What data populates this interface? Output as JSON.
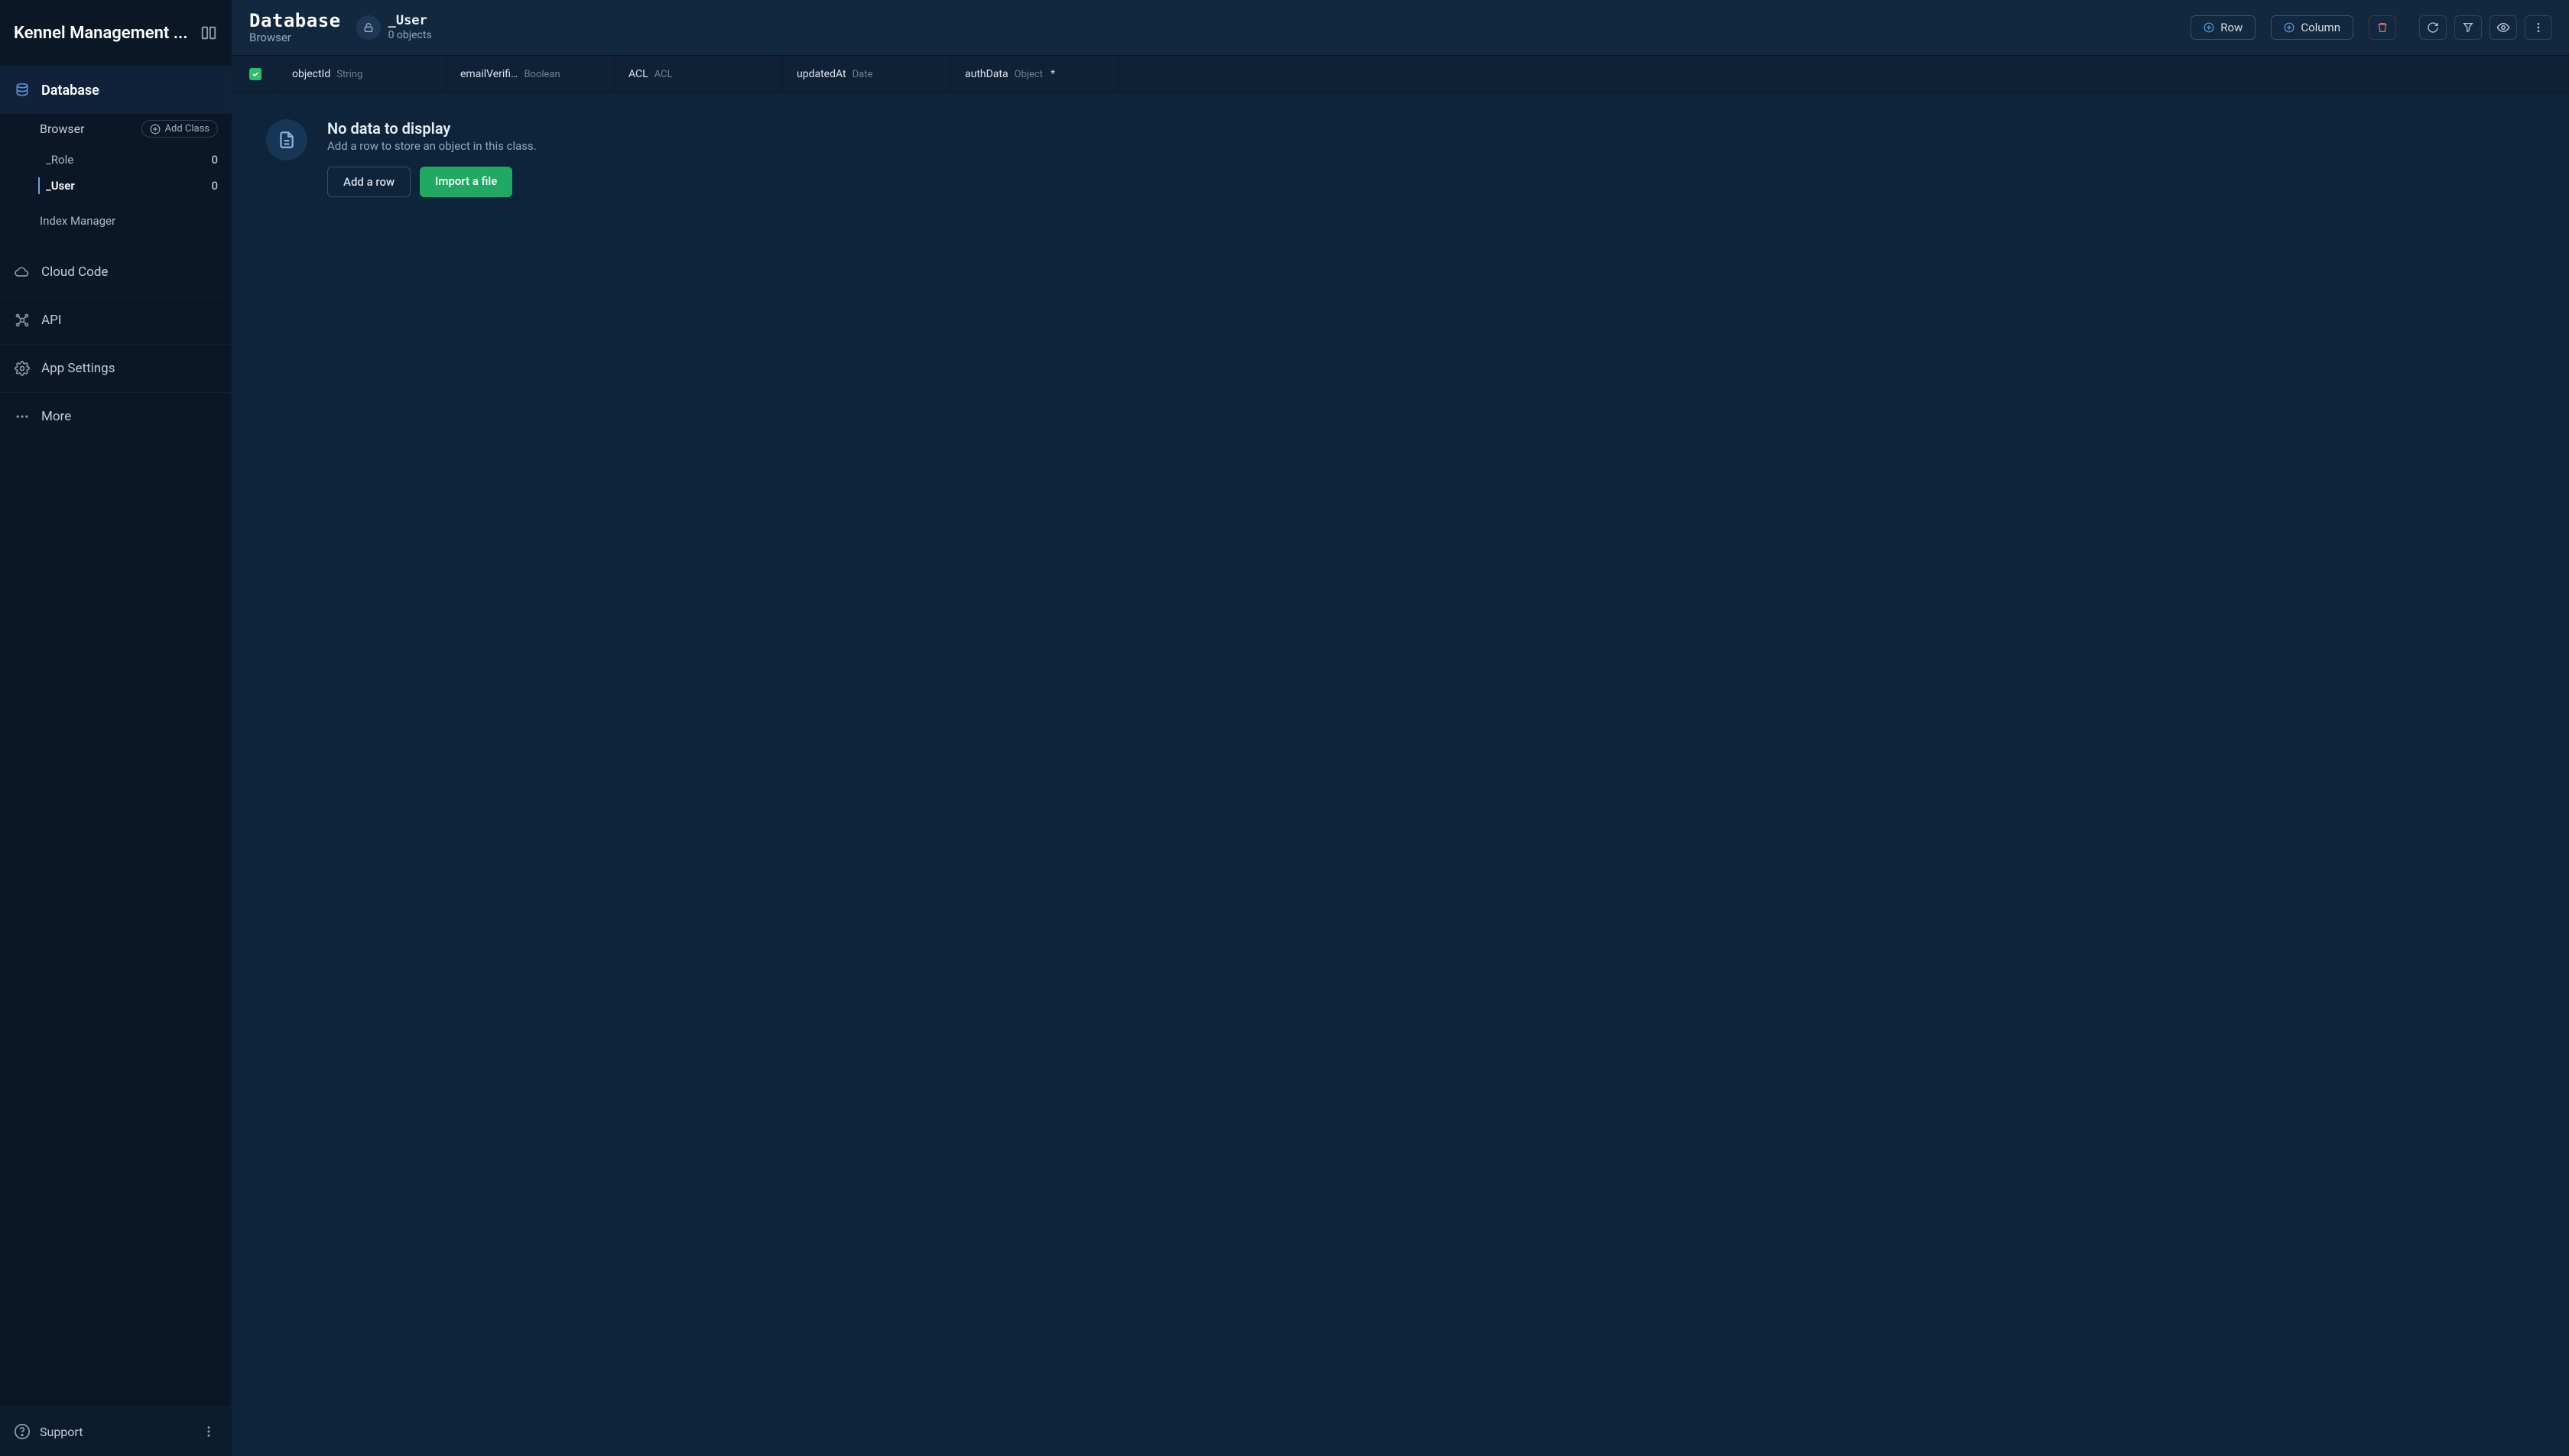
{
  "app_name": "Kennel Management ...",
  "sidebar": {
    "sections": {
      "database": {
        "label": "Database",
        "browser_label": "Browser",
        "add_class_label": "Add Class",
        "classes": [
          {
            "name": "_Role",
            "count": "0"
          },
          {
            "name": "_User",
            "count": "0"
          }
        ],
        "index_manager_label": "Index Manager"
      },
      "cloud_code": {
        "label": "Cloud Code"
      },
      "api": {
        "label": "API"
      },
      "app_settings": {
        "label": "App Settings"
      },
      "more": {
        "label": "More"
      }
    },
    "support_label": "Support"
  },
  "header": {
    "db_label": "Database",
    "browser_label": "Browser",
    "class_name": "_User",
    "object_count_label": "0 objects",
    "row_button": "Row",
    "column_button": "Column"
  },
  "columns": [
    {
      "name": "objectId",
      "type": "String",
      "required": false
    },
    {
      "name": "emailVerifi…",
      "type": "Boolean",
      "required": false
    },
    {
      "name": "ACL",
      "type": "ACL",
      "required": false
    },
    {
      "name": "updatedAt",
      "type": "Date",
      "required": false
    },
    {
      "name": "authData",
      "type": "Object",
      "required": true
    }
  ],
  "empty_state": {
    "title": "No data to display",
    "subtitle": "Add a row to store an object in this class.",
    "add_row_label": "Add a row",
    "import_label": "Import a file"
  }
}
